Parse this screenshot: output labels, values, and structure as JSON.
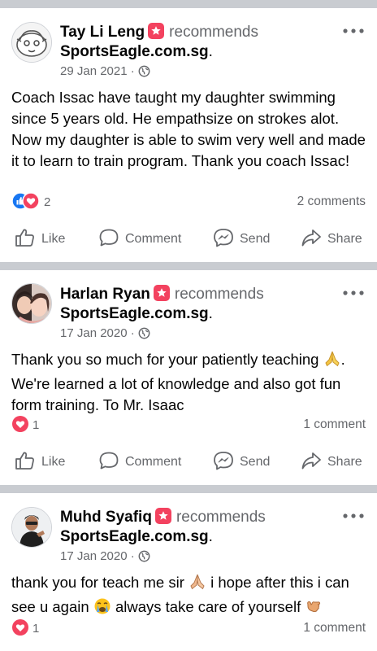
{
  "posts": [
    {
      "author": "Tay Li Leng",
      "recommends": "recommends",
      "page": "SportsEagle.com.sg",
      "date": "29 Jan 2021",
      "text": "Coach Issac have taught my daughter swimming since 5 years old. He empathsize on strokes alot. Now my daughter is able to swim very well and made it to learn to train program. Thank you coach Issac!",
      "reaction_count": "2",
      "comments": "2 comments",
      "avatar_icon": "cartoon-face-avatar"
    },
    {
      "author": "Harlan Ryan",
      "recommends": "recommends",
      "page": "SportsEagle.com.sg",
      "date": "17 Jan 2020",
      "text_parts": [
        "Thank you so much for your patiently teaching ",
        ". We're learned a lot of knowledge and also got fun form training. To Mr. Isaac"
      ],
      "reaction_count": "1",
      "comments": "1 comment",
      "avatar_icon": "couple-photo-avatar"
    },
    {
      "author": "Muhd Syafiq",
      "recommends": "recommends",
      "page": "SportsEagle.com.sg",
      "date": "17 Jan 2020",
      "text_parts": [
        "thank you for teach me sir ",
        " i hope after this i can see u again ",
        " always take care of yourself "
      ],
      "reaction_count": "1",
      "comments": "1 comment",
      "avatar_icon": "person-photo-avatar"
    }
  ],
  "actions": {
    "like": "Like",
    "comment": "Comment",
    "send": "Send",
    "share": "Share"
  },
  "colors": {
    "like_blue": "#1877f2",
    "love_red": "#f3425f",
    "secondary_text": "#65676b",
    "separator": "#c9ccd1"
  }
}
